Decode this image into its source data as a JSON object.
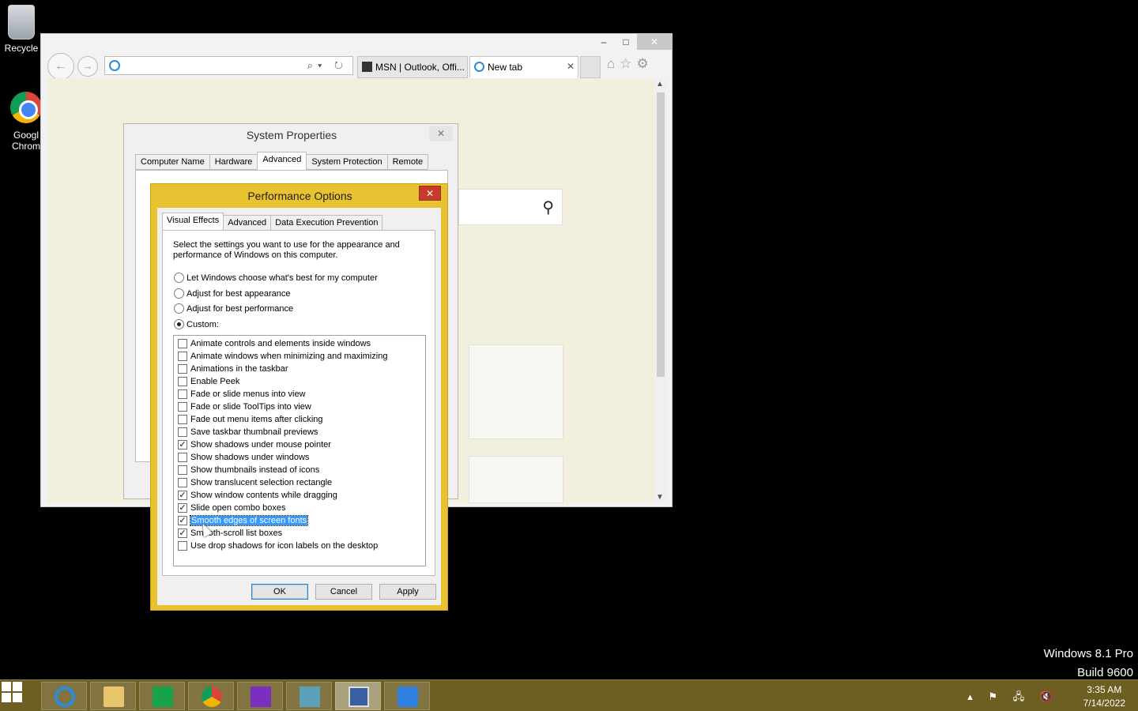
{
  "desktop": {
    "icons": [
      {
        "label": "Recycle"
      },
      {
        "label": "Googl\nChrom"
      }
    ],
    "watermark": {
      "line1": "Windows 8.1 Pro",
      "line2": "Build 9600"
    }
  },
  "browser": {
    "caption": {
      "minimize": "–",
      "maximize": "□",
      "close": "✕"
    },
    "address": {
      "value": "",
      "tools": "⌕▾ ↻"
    },
    "tabs": [
      {
        "label": "MSN | Outlook, Offi...",
        "active": false
      },
      {
        "label": "New tab",
        "active": true,
        "close": "✕"
      }
    ],
    "tools": {
      "home": "⌂",
      "favorites": "☆",
      "settings": "⚙"
    },
    "search_icon": "⚲"
  },
  "system_properties": {
    "title": "System Properties",
    "close": "✕",
    "tabs": [
      "Computer Name",
      "Hardware",
      "Advanced",
      "System Protection",
      "Remote"
    ],
    "active_tab": "Advanced"
  },
  "performance_options": {
    "title": "Performance Options",
    "close": "✕",
    "tabs": [
      "Visual Effects",
      "Advanced",
      "Data Execution Prevention"
    ],
    "active_tab": "Visual Effects",
    "description": "Select the settings you want to use for the appearance and performance of Windows on this computer.",
    "radios": [
      {
        "label": "Let Windows choose what's best for my computer",
        "checked": false
      },
      {
        "label": "Adjust for best appearance",
        "checked": false
      },
      {
        "label": "Adjust for best performance",
        "checked": false
      },
      {
        "label": "Custom:",
        "checked": true
      }
    ],
    "effects": [
      {
        "label": "Animate controls and elements inside windows",
        "checked": false
      },
      {
        "label": "Animate windows when minimizing and maximizing",
        "checked": false
      },
      {
        "label": "Animations in the taskbar",
        "checked": false
      },
      {
        "label": "Enable Peek",
        "checked": false
      },
      {
        "label": "Fade or slide menus into view",
        "checked": false
      },
      {
        "label": "Fade or slide ToolTips into view",
        "checked": false
      },
      {
        "label": "Fade out menu items after clicking",
        "checked": false
      },
      {
        "label": "Save taskbar thumbnail previews",
        "checked": false
      },
      {
        "label": "Show shadows under mouse pointer",
        "checked": true
      },
      {
        "label": "Show shadows under windows",
        "checked": false
      },
      {
        "label": "Show thumbnails instead of icons",
        "checked": false
      },
      {
        "label": "Show translucent selection rectangle",
        "checked": false
      },
      {
        "label": "Show window contents while dragging",
        "checked": true
      },
      {
        "label": "Slide open combo boxes",
        "checked": true
      },
      {
        "label": "Smooth edges of screen fonts",
        "checked": true,
        "selected": true
      },
      {
        "label": "Smooth-scroll list boxes",
        "checked": true
      },
      {
        "label": "Use drop shadows for icon labels on the desktop",
        "checked": false
      }
    ],
    "buttons": {
      "ok": "OK",
      "cancel": "Cancel",
      "apply": "Apply"
    }
  },
  "taskbar": {
    "apps": [
      "start",
      "internet-explorer",
      "file-explorer",
      "store",
      "chrome",
      "search-app",
      "app-installer",
      "remote-desktop",
      "settings-app"
    ],
    "active_app": "remote-desktop",
    "tray": "▴ ⚑ 🖧 🔇",
    "clock": {
      "time": "3:35 AM",
      "date": "7/14/2022"
    }
  },
  "colors": {
    "dialog_accent": "#e8c231",
    "taskbar": "#6d5e22",
    "selection": "#3399ff",
    "close_red": "#c7392c"
  }
}
